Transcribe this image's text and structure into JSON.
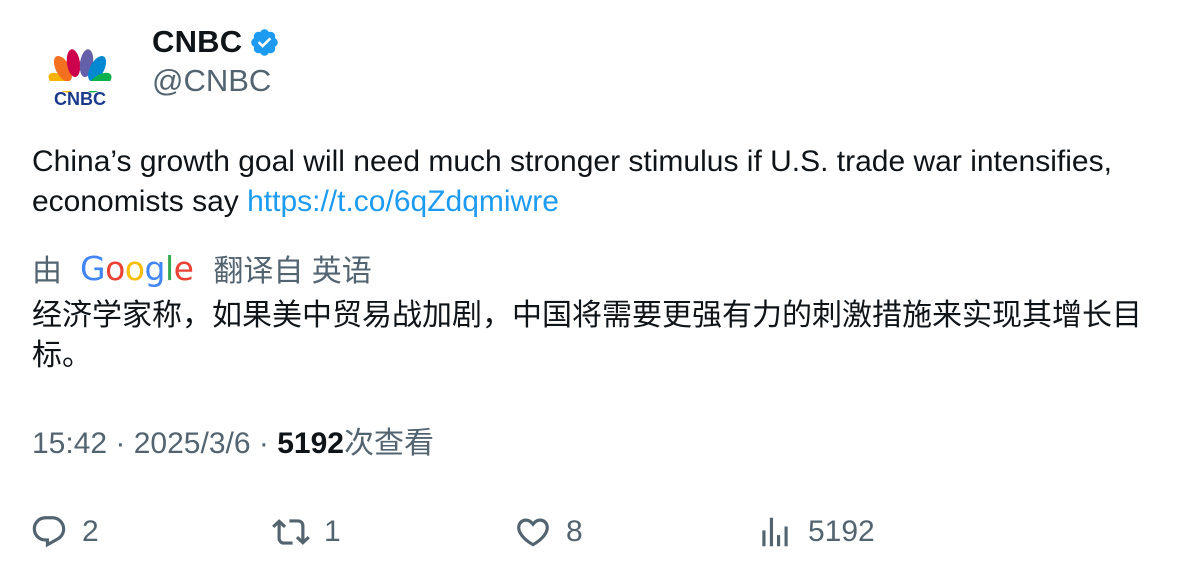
{
  "author": {
    "name": "CNBC",
    "handle": "@CNBC",
    "verified": true,
    "avatar_logo_text": "CNBC"
  },
  "tweet": {
    "text": "China’s growth goal will need much stronger stimulus if U.S. trade war intensifies, economists say ",
    "link": "https://t.co/6qZdqmiwre"
  },
  "translation": {
    "prefix": "由",
    "provider": "Google",
    "suffix": "翻译自 英语",
    "text": "经济学家称，如果美中贸易战加剧，中国将需要更强有力的刺激措施来实现其增长目标。"
  },
  "meta": {
    "time": "15:42",
    "separator": " · ",
    "date": "2025/3/6",
    "views_count": "5192",
    "views_label": "次查看"
  },
  "actions": {
    "replies": "2",
    "retweets": "1",
    "likes": "8",
    "views": "5192"
  },
  "colors": {
    "text_primary": "#0f1419",
    "text_secondary": "#536471",
    "link": "#1d9bf0",
    "verified_badge": "#1d9bf0"
  },
  "icons": {
    "reply": "reply-icon",
    "retweet": "retweet-icon",
    "like": "heart-icon",
    "views": "analytics-icon",
    "verified": "verified-badge-icon"
  }
}
